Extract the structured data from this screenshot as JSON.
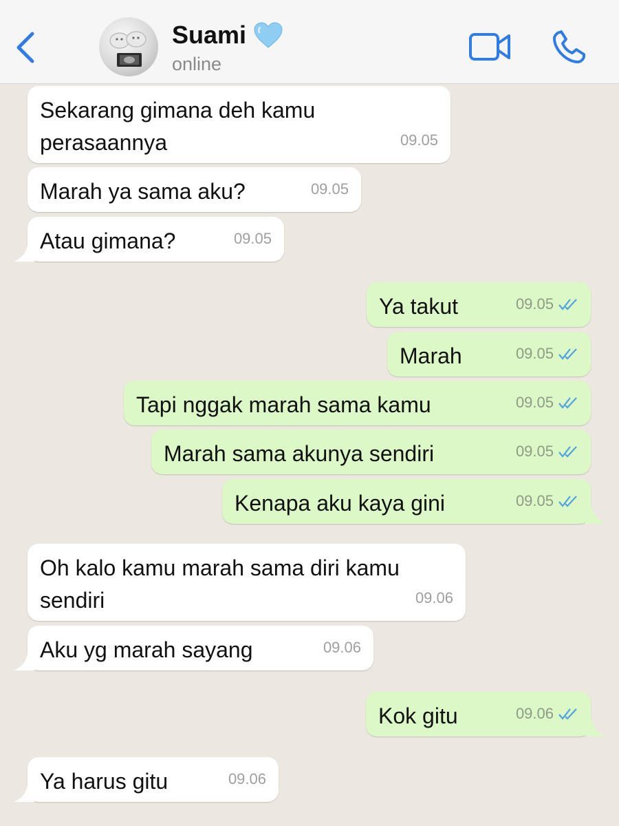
{
  "header": {
    "back_icon": "chevron-left-icon",
    "contact_name": "Suami",
    "name_emoji": "light-blue-heart-icon",
    "status": "online",
    "video_icon": "video-camera-icon",
    "call_icon": "phone-icon"
  },
  "colors": {
    "accent": "#2f7ce6",
    "chat_background": "#ece8e1",
    "incoming_bubble": "#ffffff",
    "outgoing_bubble": "#dcf8c6",
    "read_ticks": "#4fa3e0"
  },
  "messages": [
    {
      "direction": "incoming",
      "text": "Sekarang gimana deh kamu perasaannya",
      "time": "09.05"
    },
    {
      "direction": "incoming",
      "text": "Marah ya sama aku?",
      "time": "09.05"
    },
    {
      "direction": "incoming",
      "text": "Atau gimana?",
      "time": "09.05"
    },
    {
      "direction": "outgoing",
      "text": "Ya takut",
      "time": "09.05",
      "status": "read"
    },
    {
      "direction": "outgoing",
      "text": "Marah",
      "time": "09.05",
      "status": "read"
    },
    {
      "direction": "outgoing",
      "text": "Tapi nggak marah sama kamu",
      "time": "09.05",
      "status": "read"
    },
    {
      "direction": "outgoing",
      "text": "Marah sama akunya sendiri",
      "time": "09.05",
      "status": "read"
    },
    {
      "direction": "outgoing",
      "text": "Kenapa aku kaya gini",
      "time": "09.05",
      "status": "read"
    },
    {
      "direction": "incoming",
      "text": "Oh kalo kamu marah sama diri kamu sendiri",
      "time": "09.06"
    },
    {
      "direction": "incoming",
      "text": "Aku yg marah sayang",
      "time": "09.06"
    },
    {
      "direction": "outgoing",
      "text": "Kok gitu",
      "time": "09.06",
      "status": "read"
    },
    {
      "direction": "incoming",
      "text": "Ya harus gitu",
      "time": "09.06"
    }
  ]
}
